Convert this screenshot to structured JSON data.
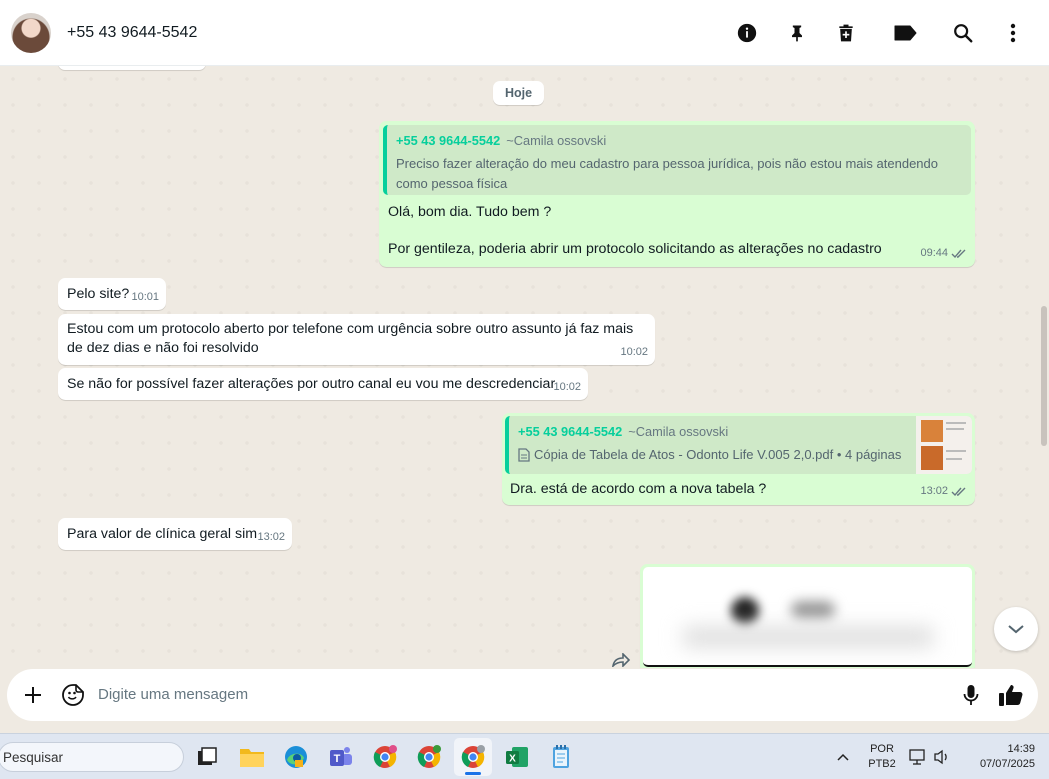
{
  "header": {
    "contact_name": "+55 43 9644-5542",
    "icons": [
      "info-icon",
      "pin-icon",
      "trash-icon",
      "label-icon",
      "search-icon",
      "more-icon"
    ]
  },
  "chat": {
    "day_chip": "Hoje",
    "messages": [
      {
        "direction": "out",
        "quote_sender": "+55 43 9644-5542",
        "quote_alias": "~Camila ossovski",
        "quote_text": "Preciso fazer alteração do meu cadastro para pessoa jurídica, pois não estou mais atendendo como pessoa física",
        "line1": "Olá, bom dia. Tudo bem ?",
        "line2": "Por gentileza, poderia abrir um protocolo solicitando as alterações no cadastro",
        "time": "09:44"
      },
      {
        "direction": "in",
        "text": "Pelo site?",
        "time": "10:01"
      },
      {
        "direction": "in",
        "text": "Estou com um protocolo aberto por telefone com urgência sobre outro assunto já faz mais de dez dias e não foi resolvido",
        "time": "10:02"
      },
      {
        "direction": "in",
        "text": "Se não for possível fazer alterações por outro canal eu vou me descredenciar",
        "time": "10:02"
      },
      {
        "direction": "out",
        "quote_sender": "+55 43 9644-5542",
        "quote_alias": "~Camila ossovski",
        "quote_doc": "Cópia de Tabela de Atos - Odonto Life V.005 2,0.pdf • 4 páginas",
        "text": "Dra. está de acordo com a nova tabela ?",
        "time": "13:02"
      },
      {
        "direction": "in",
        "text": "Para valor de clínica geral sim",
        "time": "13:02"
      }
    ]
  },
  "composer": {
    "placeholder": "Digite uma mensagem"
  },
  "taskbar": {
    "search_label": "Pesquisar",
    "lang_top": "POR",
    "lang_bottom": "PTB2",
    "time": "14:39",
    "date": "07/07/2025"
  },
  "colors": {
    "outgoing_bubble": "#d9fdd3",
    "incoming_bubble": "#ffffff",
    "accent_green": "#06cf9c",
    "chat_background": "#efeae2"
  }
}
